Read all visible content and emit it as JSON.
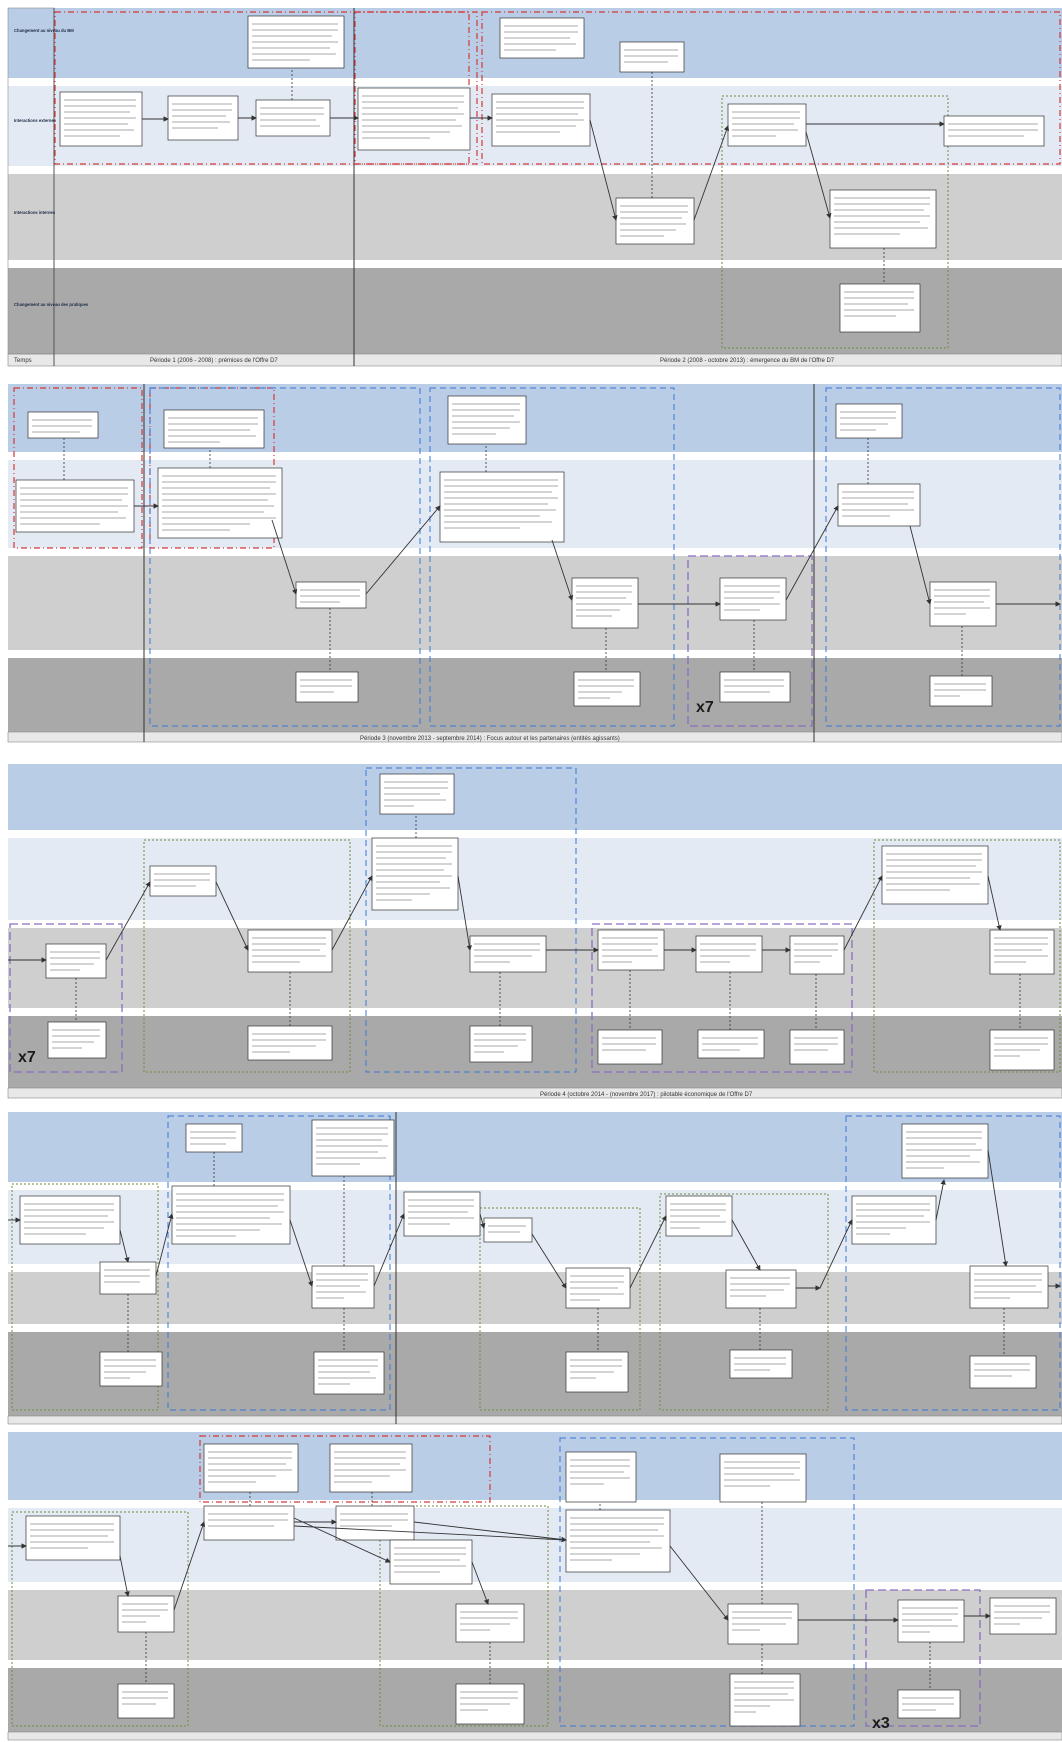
{
  "lane_labels": [
    "Changement au niveau du BM",
    "Interactions externes",
    "Interactions internes",
    "Changement au niveau des pratiques"
  ],
  "footer_label": "Temps",
  "periods": {
    "p1": "Période 1 (2006 - 2008) : prémices de l'Offre D7",
    "p2": "Période 2 (2008 - octobre 2013) : émergence du BM de l'Offre D7",
    "p3": "Période 3 (novembre 2013 - septembre 2014) : Focus autour et les partenaires (entités agissants)",
    "p4": "Période 4 (octobre 2014 - (novembre 2017) : pilotable économique de l'Offre D7"
  },
  "multipliers": {
    "s2": "x7",
    "s3": "x7",
    "s5": "x3"
  },
  "colors": {
    "lane_external": "#b9cde6",
    "lane_internal": "#e3eaf4",
    "lane_bm": "#cfcfcf",
    "lane_practice": "#a9a9a9",
    "red_frame": "#d33a3a",
    "blue_frame": "#3a78d6",
    "green_frame": "#6f8f3a",
    "purple_frame": "#8a6fc0"
  }
}
